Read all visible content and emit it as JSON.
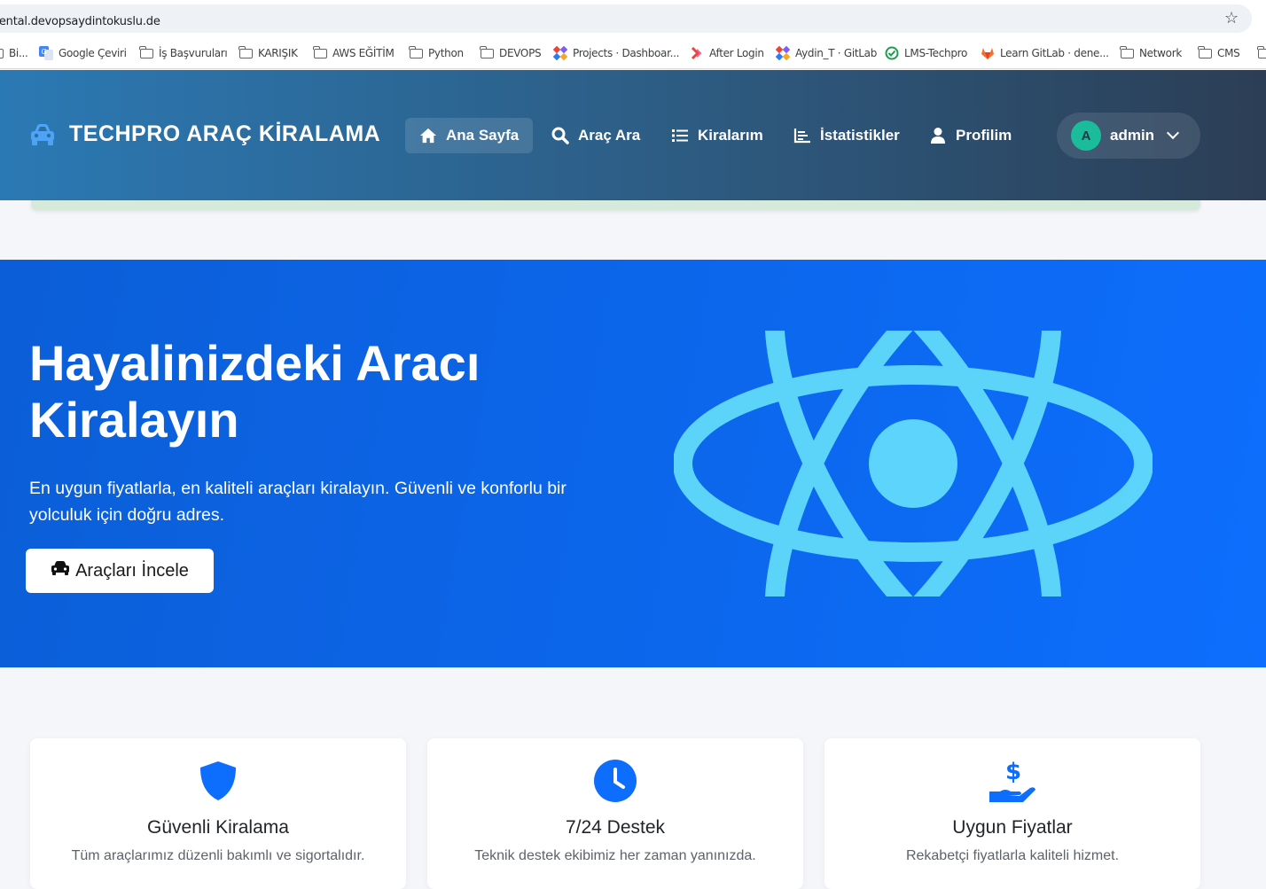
{
  "browser": {
    "url": "rental.devopsaydintokuslu.de",
    "bookmarks": [
      {
        "label": "Bi...",
        "icon": "folder-icon"
      },
      {
        "label": "Google Çeviri",
        "icon": "google-translate-icon"
      },
      {
        "label": "İş Başvuruları",
        "icon": "folder-icon"
      },
      {
        "label": "KARIŞIK",
        "icon": "folder-icon"
      },
      {
        "label": "AWS EĞİTİM",
        "icon": "folder-icon"
      },
      {
        "label": "Python",
        "icon": "folder-icon"
      },
      {
        "label": "DEVOPS",
        "icon": "folder-icon"
      },
      {
        "label": "Projects · Dashboar...",
        "icon": "pinwheel-icon"
      },
      {
        "label": "After Login",
        "icon": "chevron-logo-icon"
      },
      {
        "label": "Aydin_T · GitLab",
        "icon": "pinwheel-icon"
      },
      {
        "label": "LMS-Techpro",
        "icon": "check-circle-icon"
      },
      {
        "label": "Learn GitLab · dene...",
        "icon": "gitlab-icon"
      },
      {
        "label": "Network",
        "icon": "folder-icon"
      },
      {
        "label": "CMS",
        "icon": "folder-icon"
      }
    ]
  },
  "navbar": {
    "brand": "TECHPRO ARAÇ KİRALAMA",
    "items": [
      {
        "label": "Ana Sayfa",
        "icon": "home-icon",
        "active": true
      },
      {
        "label": "Araç Ara",
        "icon": "search-icon",
        "active": false
      },
      {
        "label": "Kiralarım",
        "icon": "list-icon",
        "active": false
      },
      {
        "label": "İstatistikler",
        "icon": "chart-icon",
        "active": false
      },
      {
        "label": "Profilim",
        "icon": "user-icon",
        "active": false
      }
    ],
    "user": {
      "initial": "A",
      "name": "admin"
    }
  },
  "hero": {
    "title": "Hayalinizdeki Aracı Kiralayın",
    "subtitle": "En uygun fiyatlarla, en kaliteli araçları kiralayın. Güvenli ve konforlu bir yolculuk için doğru adres.",
    "button": "Araçları İncele",
    "image_icon": "react-logo-icon"
  },
  "features": [
    {
      "title": "Güvenli Kiralama",
      "desc": "Tüm araçlarımız düzenli bakımlı ve sigortalıdır.",
      "icon": "shield-icon"
    },
    {
      "title": "7/24 Destek",
      "desc": "Teknik destek ekibimiz her zaman yanınızda.",
      "icon": "clock-icon"
    },
    {
      "title": "Uygun Fiyatlar",
      "desc": "Rekabetçi fiyatlarla kaliteli hizmet.",
      "icon": "hand-dollar-icon"
    }
  ],
  "colors": {
    "primary": "#0d6efd",
    "navbar_start": "#2b79b4",
    "navbar_end": "#2c3e55",
    "react_cyan": "#61dafb",
    "avatar": "#1abc9c"
  }
}
